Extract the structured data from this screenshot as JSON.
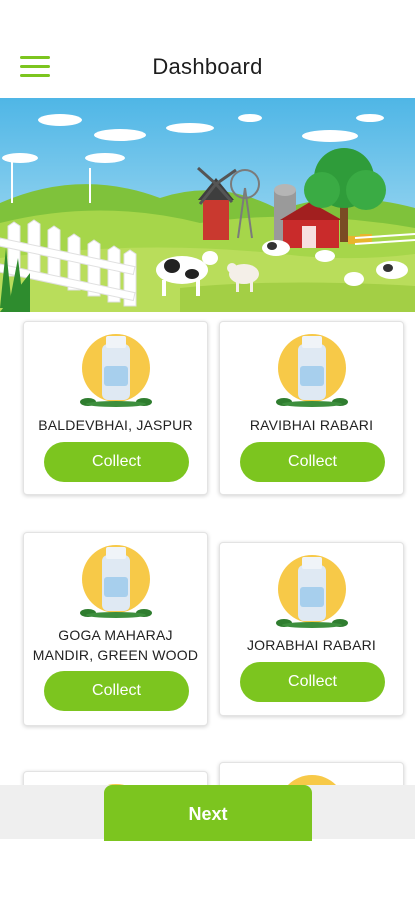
{
  "header": {
    "title": "Dashboard",
    "menu_icon": "hamburger-menu-icon"
  },
  "banner": {
    "description_icon": "farm-banner-illustration"
  },
  "cards": [
    {
      "name": "BALDEVBHAI, JASPUR",
      "button": "Collect"
    },
    {
      "name": "RAVIBHAI RABARI",
      "button": "Collect"
    },
    {
      "name": "GOGA MAHARAJ MANDIR, GREEN WOOD",
      "button": "Collect"
    },
    {
      "name": "JORABHAI RABARI",
      "button": "Collect"
    }
  ],
  "footer": {
    "next_label": "Next"
  },
  "colors": {
    "accent": "#7cc51f",
    "sun": "#f7c948",
    "milk_bottle": "#dfe9f3"
  }
}
